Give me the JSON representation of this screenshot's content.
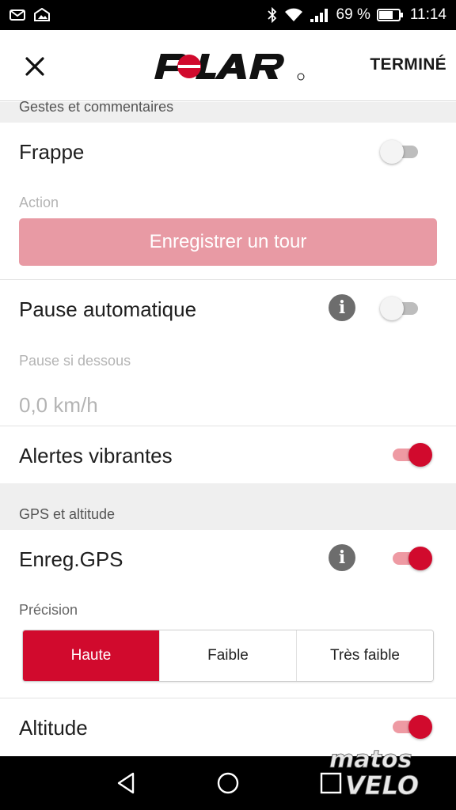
{
  "status_bar": {
    "battery_percent": "69 %",
    "time": "11:14",
    "icons": [
      "mail-icon",
      "photo-icon",
      "bluetooth-icon",
      "wifi-icon",
      "signal-icon",
      "battery-icon"
    ]
  },
  "header": {
    "close_icon": "close-icon",
    "logo_text": "POLAR",
    "done_label": "TERMINÉ"
  },
  "sections": {
    "gestures_title": "Gestes et commentaires",
    "gps_title": "GPS et altitude"
  },
  "tap": {
    "label": "Frappe",
    "enabled": false,
    "action_label": "Action",
    "action_button": "Enregistrer un tour"
  },
  "auto_pause": {
    "label": "Pause automatique",
    "enabled": false,
    "threshold_label": "Pause si dessous",
    "threshold_value": "0,0 km/h"
  },
  "vibration_alerts": {
    "label": "Alertes vibrantes",
    "enabled": true
  },
  "gps": {
    "label": "Enreg.GPS",
    "enabled": true,
    "precision_label": "Précision",
    "precision_options": [
      "Haute",
      "Faible",
      "Très faible"
    ],
    "precision_selected": "Haute"
  },
  "altitude": {
    "label": "Altitude",
    "enabled": true
  },
  "watermark": {
    "line1": "matos",
    "line2": "VELO"
  },
  "colors": {
    "accent": "#d10a2d",
    "accent_light": "#ee9aa3",
    "button_disabled": "#e89aa4",
    "section_bg": "#efefef"
  }
}
